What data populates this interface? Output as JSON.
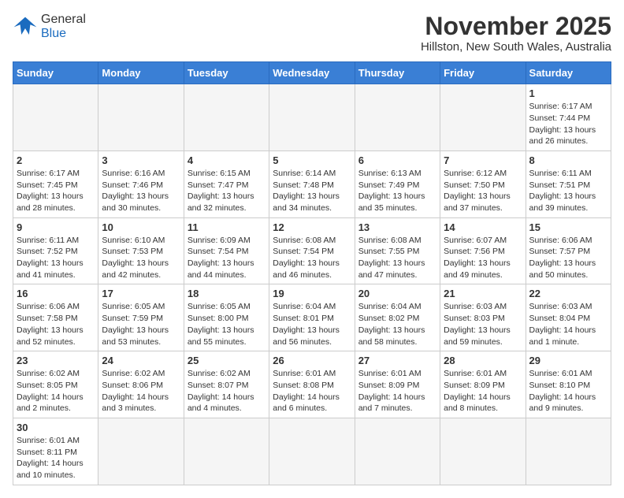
{
  "logo": {
    "general": "General",
    "blue": "Blue"
  },
  "title": "November 2025",
  "subtitle": "Hillston, New South Wales, Australia",
  "days_of_week": [
    "Sunday",
    "Monday",
    "Tuesday",
    "Wednesday",
    "Thursday",
    "Friday",
    "Saturday"
  ],
  "weeks": [
    [
      {
        "day": "",
        "info": ""
      },
      {
        "day": "",
        "info": ""
      },
      {
        "day": "",
        "info": ""
      },
      {
        "day": "",
        "info": ""
      },
      {
        "day": "",
        "info": ""
      },
      {
        "day": "",
        "info": ""
      },
      {
        "day": "1",
        "info": "Sunrise: 6:17 AM\nSunset: 7:44 PM\nDaylight: 13 hours\nand 26 minutes."
      }
    ],
    [
      {
        "day": "2",
        "info": "Sunrise: 6:17 AM\nSunset: 7:45 PM\nDaylight: 13 hours\nand 28 minutes."
      },
      {
        "day": "3",
        "info": "Sunrise: 6:16 AM\nSunset: 7:46 PM\nDaylight: 13 hours\nand 30 minutes."
      },
      {
        "day": "4",
        "info": "Sunrise: 6:15 AM\nSunset: 7:47 PM\nDaylight: 13 hours\nand 32 minutes."
      },
      {
        "day": "5",
        "info": "Sunrise: 6:14 AM\nSunset: 7:48 PM\nDaylight: 13 hours\nand 34 minutes."
      },
      {
        "day": "6",
        "info": "Sunrise: 6:13 AM\nSunset: 7:49 PM\nDaylight: 13 hours\nand 35 minutes."
      },
      {
        "day": "7",
        "info": "Sunrise: 6:12 AM\nSunset: 7:50 PM\nDaylight: 13 hours\nand 37 minutes."
      },
      {
        "day": "8",
        "info": "Sunrise: 6:11 AM\nSunset: 7:51 PM\nDaylight: 13 hours\nand 39 minutes."
      }
    ],
    [
      {
        "day": "9",
        "info": "Sunrise: 6:11 AM\nSunset: 7:52 PM\nDaylight: 13 hours\nand 41 minutes."
      },
      {
        "day": "10",
        "info": "Sunrise: 6:10 AM\nSunset: 7:53 PM\nDaylight: 13 hours\nand 42 minutes."
      },
      {
        "day": "11",
        "info": "Sunrise: 6:09 AM\nSunset: 7:54 PM\nDaylight: 13 hours\nand 44 minutes."
      },
      {
        "day": "12",
        "info": "Sunrise: 6:08 AM\nSunset: 7:54 PM\nDaylight: 13 hours\nand 46 minutes."
      },
      {
        "day": "13",
        "info": "Sunrise: 6:08 AM\nSunset: 7:55 PM\nDaylight: 13 hours\nand 47 minutes."
      },
      {
        "day": "14",
        "info": "Sunrise: 6:07 AM\nSunset: 7:56 PM\nDaylight: 13 hours\nand 49 minutes."
      },
      {
        "day": "15",
        "info": "Sunrise: 6:06 AM\nSunset: 7:57 PM\nDaylight: 13 hours\nand 50 minutes."
      }
    ],
    [
      {
        "day": "16",
        "info": "Sunrise: 6:06 AM\nSunset: 7:58 PM\nDaylight: 13 hours\nand 52 minutes."
      },
      {
        "day": "17",
        "info": "Sunrise: 6:05 AM\nSunset: 7:59 PM\nDaylight: 13 hours\nand 53 minutes."
      },
      {
        "day": "18",
        "info": "Sunrise: 6:05 AM\nSunset: 8:00 PM\nDaylight: 13 hours\nand 55 minutes."
      },
      {
        "day": "19",
        "info": "Sunrise: 6:04 AM\nSunset: 8:01 PM\nDaylight: 13 hours\nand 56 minutes."
      },
      {
        "day": "20",
        "info": "Sunrise: 6:04 AM\nSunset: 8:02 PM\nDaylight: 13 hours\nand 58 minutes."
      },
      {
        "day": "21",
        "info": "Sunrise: 6:03 AM\nSunset: 8:03 PM\nDaylight: 13 hours\nand 59 minutes."
      },
      {
        "day": "22",
        "info": "Sunrise: 6:03 AM\nSunset: 8:04 PM\nDaylight: 14 hours\nand 1 minute."
      }
    ],
    [
      {
        "day": "23",
        "info": "Sunrise: 6:02 AM\nSunset: 8:05 PM\nDaylight: 14 hours\nand 2 minutes."
      },
      {
        "day": "24",
        "info": "Sunrise: 6:02 AM\nSunset: 8:06 PM\nDaylight: 14 hours\nand 3 minutes."
      },
      {
        "day": "25",
        "info": "Sunrise: 6:02 AM\nSunset: 8:07 PM\nDaylight: 14 hours\nand 4 minutes."
      },
      {
        "day": "26",
        "info": "Sunrise: 6:01 AM\nSunset: 8:08 PM\nDaylight: 14 hours\nand 6 minutes."
      },
      {
        "day": "27",
        "info": "Sunrise: 6:01 AM\nSunset: 8:09 PM\nDaylight: 14 hours\nand 7 minutes."
      },
      {
        "day": "28",
        "info": "Sunrise: 6:01 AM\nSunset: 8:09 PM\nDaylight: 14 hours\nand 8 minutes."
      },
      {
        "day": "29",
        "info": "Sunrise: 6:01 AM\nSunset: 8:10 PM\nDaylight: 14 hours\nand 9 minutes."
      }
    ],
    [
      {
        "day": "30",
        "info": "Sunrise: 6:01 AM\nSunset: 8:11 PM\nDaylight: 14 hours\nand 10 minutes."
      },
      {
        "day": "",
        "info": ""
      },
      {
        "day": "",
        "info": ""
      },
      {
        "day": "",
        "info": ""
      },
      {
        "day": "",
        "info": ""
      },
      {
        "day": "",
        "info": ""
      },
      {
        "day": "",
        "info": ""
      }
    ]
  ]
}
